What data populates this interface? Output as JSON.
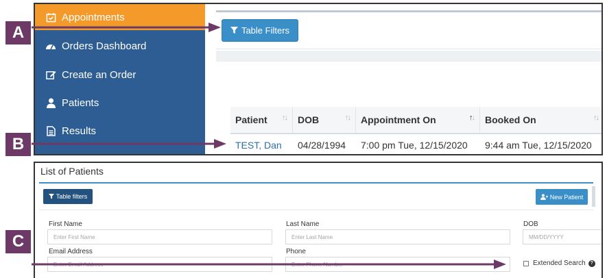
{
  "sidebar": {
    "items": [
      {
        "label": "Appointments",
        "icon": "calendar-check-icon",
        "active": true
      },
      {
        "label": "Orders Dashboard",
        "icon": "dashboard-icon",
        "active": false
      },
      {
        "label": "Create an Order",
        "icon": "edit-icon",
        "active": false
      },
      {
        "label": "Patients",
        "icon": "user-icon",
        "active": false
      },
      {
        "label": "Results",
        "icon": "file-icon",
        "active": false
      }
    ]
  },
  "appointments": {
    "table_filters_label": "Table Filters",
    "columns": [
      "Patient",
      "DOB",
      "Appointment On",
      "Booked On"
    ],
    "rows": [
      {
        "patient": "TEST, Dan",
        "dob": "04/28/1994",
        "appointment_on": "7:00 pm Tue, 12/15/2020",
        "booked_on": "9:44 am Tue, 12/15/2020"
      }
    ]
  },
  "patients": {
    "title": "List of Patients",
    "table_filters_label": "Table filters",
    "new_patient_label": "New Patient",
    "fields": {
      "first_name": {
        "label": "First Name",
        "placeholder": "Enter First Name"
      },
      "last_name": {
        "label": "Last Name",
        "placeholder": "Enter Last Name"
      },
      "dob": {
        "label": "DOB",
        "placeholder": "MM/DD/YYYY"
      },
      "email": {
        "label": "Email Address",
        "placeholder": "Enter Email Address"
      },
      "phone": {
        "label": "Phone",
        "placeholder": "Enter Phone Number"
      }
    },
    "extended_search_label": "Extended Search"
  },
  "callouts": {
    "a": "A",
    "b": "B",
    "c": "C"
  },
  "colors": {
    "sidebar": "#2d5d92",
    "active": "#f39a2b",
    "button": "#3a8fc8",
    "dark_button": "#24527f",
    "callout": "#6d3a67"
  }
}
